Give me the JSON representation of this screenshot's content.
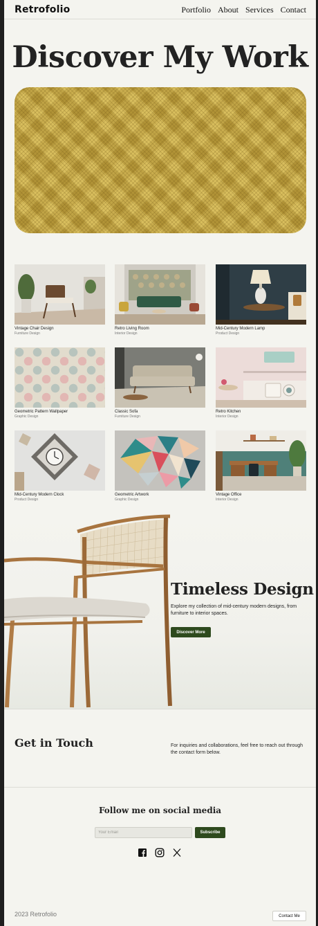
{
  "header": {
    "logo": "Retrofolio",
    "nav": [
      "Portfolio",
      "About",
      "Services",
      "Contact"
    ]
  },
  "hero": {
    "title": "Discover My Work",
    "art_colors": {
      "base": "#c9ab45",
      "shade": "#6e5514"
    }
  },
  "projects": [
    {
      "title": "Vintage Chair Design",
      "category": "Furniture Design",
      "icon": "chair-photo"
    },
    {
      "title": "Retro Living Room",
      "category": "Interior Design",
      "icon": "living-room-photo"
    },
    {
      "title": "Mid-Century Modern Lamp",
      "category": "Product Design",
      "icon": "lamp-photo"
    },
    {
      "title": "Geometric Pattern Wallpaper",
      "category": "Graphic Design",
      "icon": "wallpaper-photo"
    },
    {
      "title": "Classic Sofa",
      "category": "Furniture Design",
      "icon": "sofa-photo"
    },
    {
      "title": "Retro Kitchen",
      "category": "Interior Design",
      "icon": "kitchen-photo"
    },
    {
      "title": "Mid-Century Modern Clock",
      "category": "Product Design",
      "icon": "clock-photo"
    },
    {
      "title": "Geometric Artwork",
      "category": "Graphic Design",
      "icon": "artwork-photo"
    },
    {
      "title": "Vintage Office",
      "category": "Interior Design",
      "icon": "office-photo"
    }
  ],
  "feature": {
    "title": "Timeless Design",
    "text": "Explore my collection of mid-century modern designs, from furniture to interior spaces.",
    "button": "Discover More"
  },
  "contact": {
    "title": "Get in Touch",
    "text": "For inquiries and collaborations, feel free to reach out through the contact form below."
  },
  "social": {
    "title": "Follow me on social media",
    "email_placeholder": "Your Email",
    "email_value": "",
    "subscribe": "Subscribe",
    "icons": [
      "facebook-icon",
      "instagram-icon",
      "x-icon"
    ]
  },
  "footer": {
    "copyright": "2023 Retrofolio",
    "contact_button": "Contact Me"
  },
  "colors": {
    "accent": "#2e4a1e",
    "background": "#f4f4ef",
    "frame": "#1f1f1f"
  }
}
